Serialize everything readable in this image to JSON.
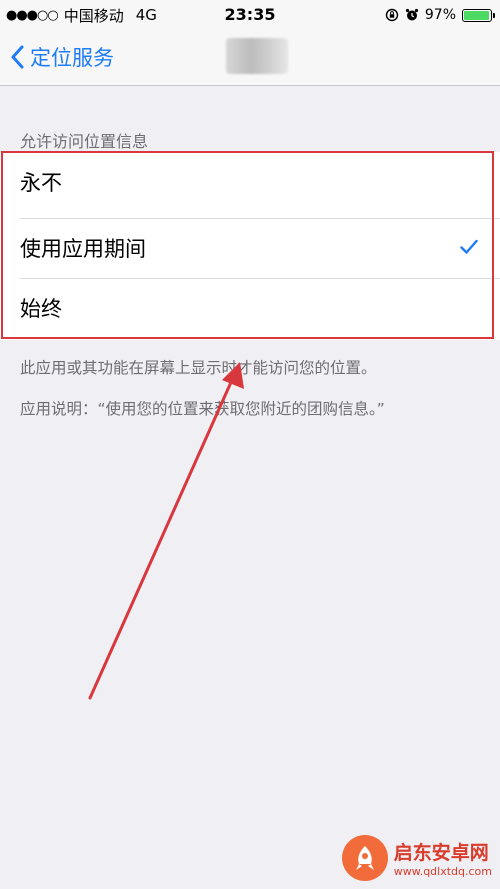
{
  "status_bar": {
    "signal": "●●●○○",
    "carrier": "中国移动",
    "network": "4G",
    "time": "23:35",
    "battery_percent": "97%",
    "battery_level": 0.97,
    "battery_color": "#4cd964"
  },
  "nav": {
    "back_label": "定位服务",
    "accent_color": "#1e7cf7"
  },
  "section": {
    "header": "允许访问位置信息"
  },
  "options": [
    {
      "label": "永不",
      "selected": false
    },
    {
      "label": "使用应用期间",
      "selected": true
    },
    {
      "label": "始终",
      "selected": false
    }
  ],
  "footer": {
    "description": "此应用或其功能在屏幕上显示时才能访问您的位置。",
    "app_note": "应用说明：“使用您的位置来获取您附近的团购信息。”"
  },
  "annotation": {
    "color": "#d8373d"
  },
  "watermark": {
    "title": "启东安卓网",
    "url": "www.qdlxtdq.com"
  }
}
